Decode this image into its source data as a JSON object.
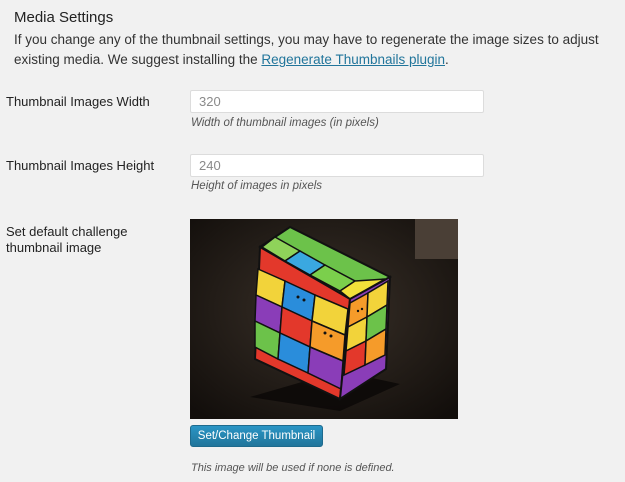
{
  "section": {
    "title": "Media Settings",
    "description_pre": "If you change any of the thumbnail settings, you may have to regenerate the image sizes to adjust existing media. We suggest installing the ",
    "link_text": "Regenerate Thumbnails plugin",
    "description_post": "."
  },
  "thumbnail_width": {
    "label": "Thumbnail Images Width",
    "value": "320",
    "description": "Width of thumbnail images (in pixels)"
  },
  "thumbnail_height": {
    "label": "Thumbnail Images Height",
    "value": "240",
    "description": "Height of images in pixels"
  },
  "default_thumbnail": {
    "label": "Set default challenge thumbnail image",
    "image_alt": "Colorful cube puzzle thumbnail",
    "button_label": "Set/Change Thumbnail",
    "note": "This image will be used if none is defined."
  },
  "colors": {
    "link": "#21759b",
    "button": "#21759b",
    "background": "#f1f1f1"
  }
}
